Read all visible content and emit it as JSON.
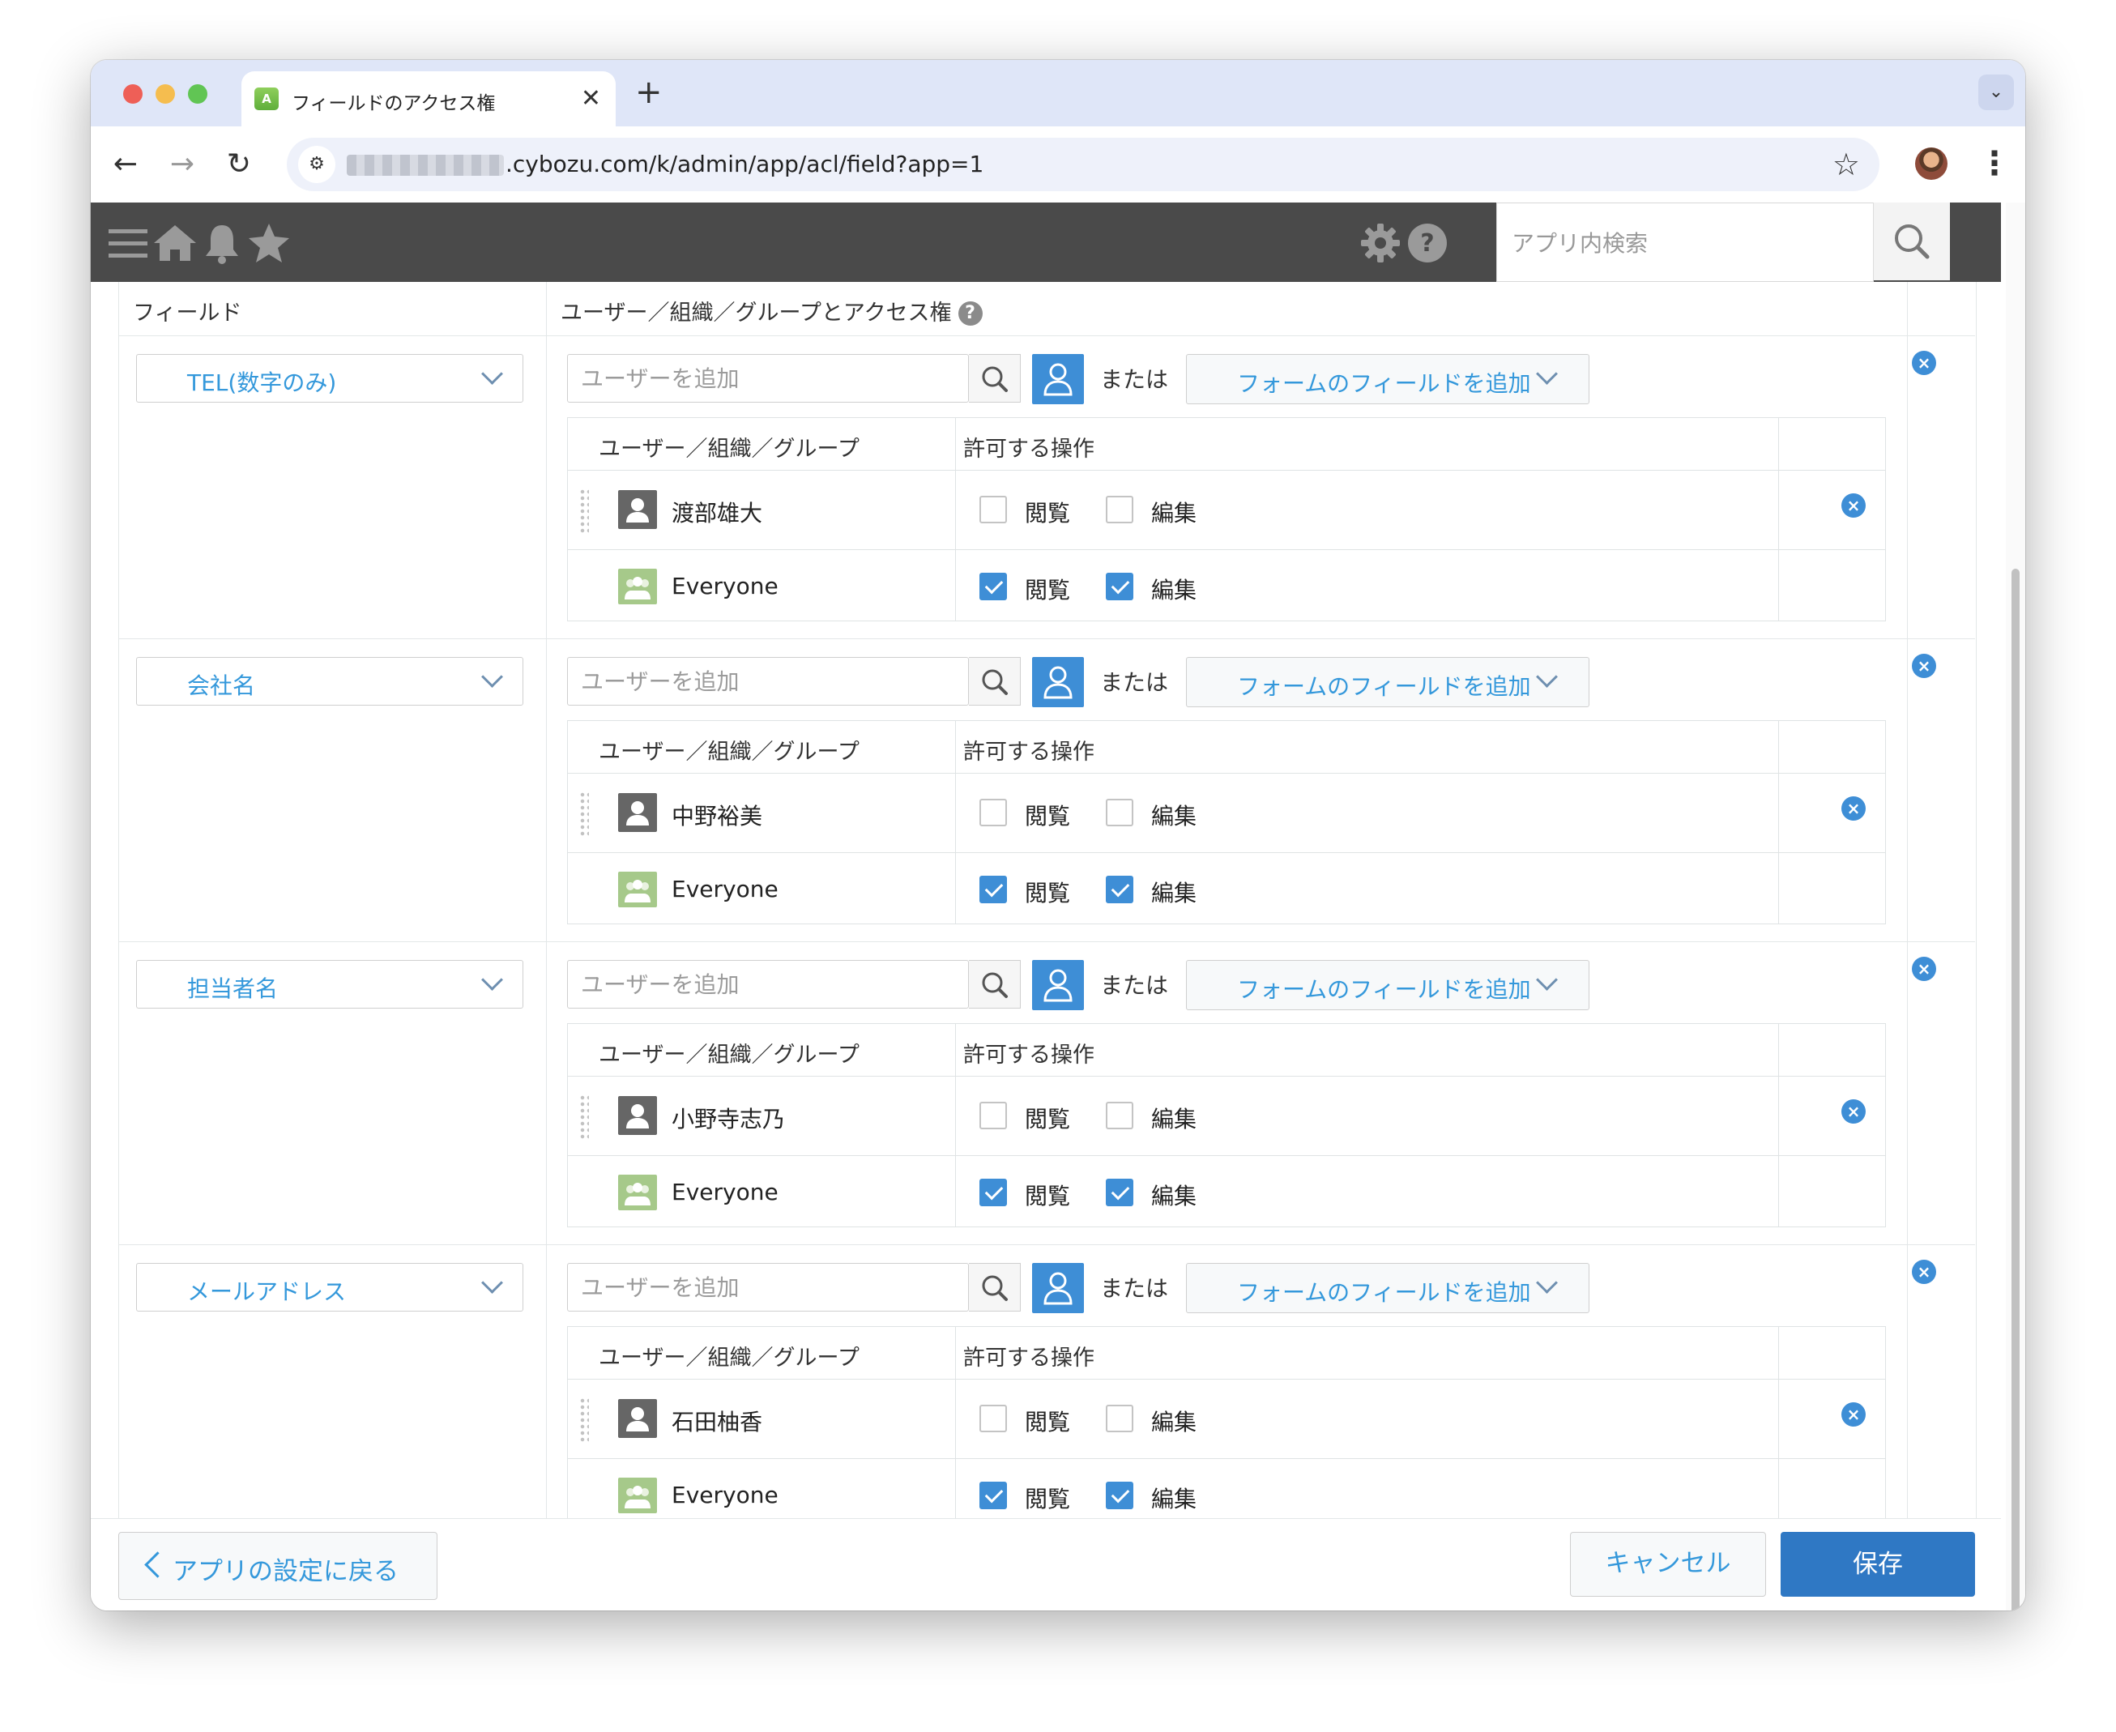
{
  "browser": {
    "tab_title": "フィールドのアクセス権",
    "favicon_text": "A",
    "url_text": ".cybozu.com/k/admin/app/acl/field?app=1"
  },
  "header": {
    "search_placeholder": "アプリ内検索",
    "icons": [
      "menu-icon",
      "home-icon",
      "bell-icon",
      "star-icon",
      "gear-icon",
      "help-icon",
      "search-icon"
    ]
  },
  "table": {
    "col_field": "フィールド",
    "col_access": "ユーザー／組織／グループとアクセス権"
  },
  "labels": {
    "user_placeholder": "ユーザーを追加",
    "or": "または",
    "add_field": "フォームのフィールドを追加",
    "entity_header": "ユーザー／組織／グループ",
    "perm_header": "許可する操作",
    "view": "閲覧",
    "edit": "編集"
  },
  "rows": [
    {
      "field": "TEL(数字のみ)",
      "entities": [
        {
          "name": "渡部雄大",
          "type": "user",
          "view": false,
          "edit": false
        },
        {
          "name": "Everyone",
          "type": "group",
          "view": true,
          "edit": true
        }
      ]
    },
    {
      "field": "会社名",
      "entities": [
        {
          "name": "中野裕美",
          "type": "user",
          "view": false,
          "edit": false
        },
        {
          "name": "Everyone",
          "type": "group",
          "view": true,
          "edit": true
        }
      ]
    },
    {
      "field": "担当者名",
      "entities": [
        {
          "name": "小野寺志乃",
          "type": "user",
          "view": false,
          "edit": false
        },
        {
          "name": "Everyone",
          "type": "group",
          "view": true,
          "edit": true
        }
      ]
    },
    {
      "field": "メールアドレス",
      "entities": [
        {
          "name": "石田柚香",
          "type": "user",
          "view": false,
          "edit": false
        },
        {
          "name": "Everyone",
          "type": "group",
          "view": true,
          "edit": true
        }
      ]
    }
  ],
  "footer": {
    "back_label": "アプリの設定に戻る",
    "cancel_label": "キャンセル",
    "save_label": "保存"
  },
  "colors": {
    "accent": "#3498db",
    "primary_button": "#2f78c4",
    "header_bg": "#4a4a4a",
    "tab_strip": "#dfe6f8"
  }
}
